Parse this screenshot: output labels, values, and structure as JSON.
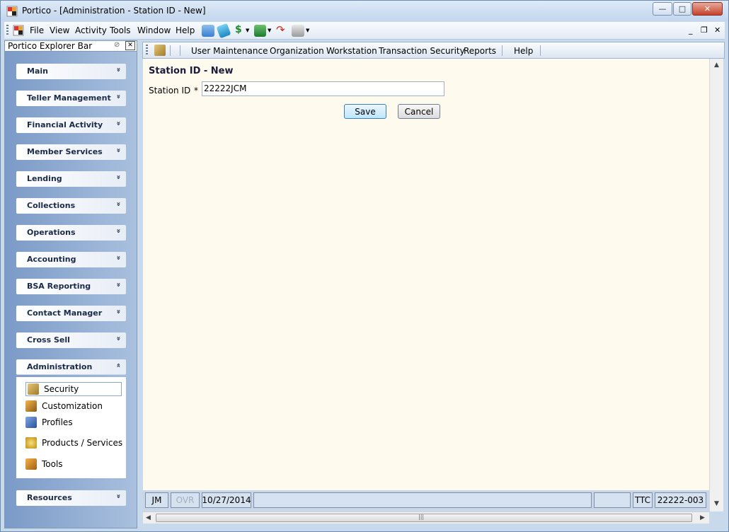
{
  "window": {
    "title": "Portico - [Administration - Station ID - New]",
    "min_glyph": "—",
    "max_glyph": "□",
    "close_glyph": "✕"
  },
  "menubar": {
    "items": [
      "File",
      "View",
      "Activity",
      "Tools",
      "Window",
      "Help"
    ],
    "mdi_min": "_",
    "mdi_restore": "❐",
    "mdi_close": "✕"
  },
  "explorer": {
    "title": "Portico Explorer Bar",
    "categories": [
      {
        "label": "Main",
        "chevron": "»"
      },
      {
        "label": "Teller Management",
        "chevron": "»"
      },
      {
        "label": "Financial Activity",
        "chevron": "»"
      },
      {
        "label": "Member Services",
        "chevron": "»"
      },
      {
        "label": "Lending",
        "chevron": "»"
      },
      {
        "label": "Collections",
        "chevron": "»"
      },
      {
        "label": "Operations",
        "chevron": "»"
      },
      {
        "label": "Accounting",
        "chevron": "»"
      },
      {
        "label": "BSA Reporting",
        "chevron": "»"
      },
      {
        "label": "Contact Manager",
        "chevron": "»"
      },
      {
        "label": "Cross Sell",
        "chevron": "»"
      },
      {
        "label": "Administration",
        "chevron": "«"
      },
      {
        "label": "Resources",
        "chevron": "»"
      }
    ],
    "admin_items": [
      {
        "label": "Security",
        "icon": "key-icon",
        "color": "#c9a24a"
      },
      {
        "label": "Customization",
        "icon": "customization-icon",
        "color": "#d08a1e"
      },
      {
        "label": "Profiles",
        "icon": "profiles-icon",
        "color": "#3a6fc1"
      },
      {
        "label": "Products / Services",
        "icon": "products-icon",
        "color": "#d9b326"
      },
      {
        "label": "Tools",
        "icon": "tools-icon",
        "color": "#d98a1a"
      }
    ]
  },
  "work_menu": {
    "items": [
      "User Maintenance",
      "Organization",
      "Workstation",
      "Transaction Security",
      "Reports",
      "Help"
    ]
  },
  "form": {
    "title": "Station ID - New",
    "field_label": "Station ID",
    "required_mark": "*",
    "field_value": "22222JCM",
    "save_label": "Save",
    "cancel_label": "Cancel"
  },
  "status": {
    "user": "JM",
    "ovr": "OVR",
    "date": "10/27/2014",
    "ttc": "TTC",
    "station": "22222-003"
  },
  "scroll": {
    "left_arrow": "◀",
    "right_arrow": "▶",
    "up_arrow": "▲",
    "down_arrow": "▼",
    "grip": "|||"
  },
  "colors": {
    "content_bg": "#fefaee",
    "explorer_bg": "#7b9ac7",
    "accent": "#1b2a46"
  }
}
